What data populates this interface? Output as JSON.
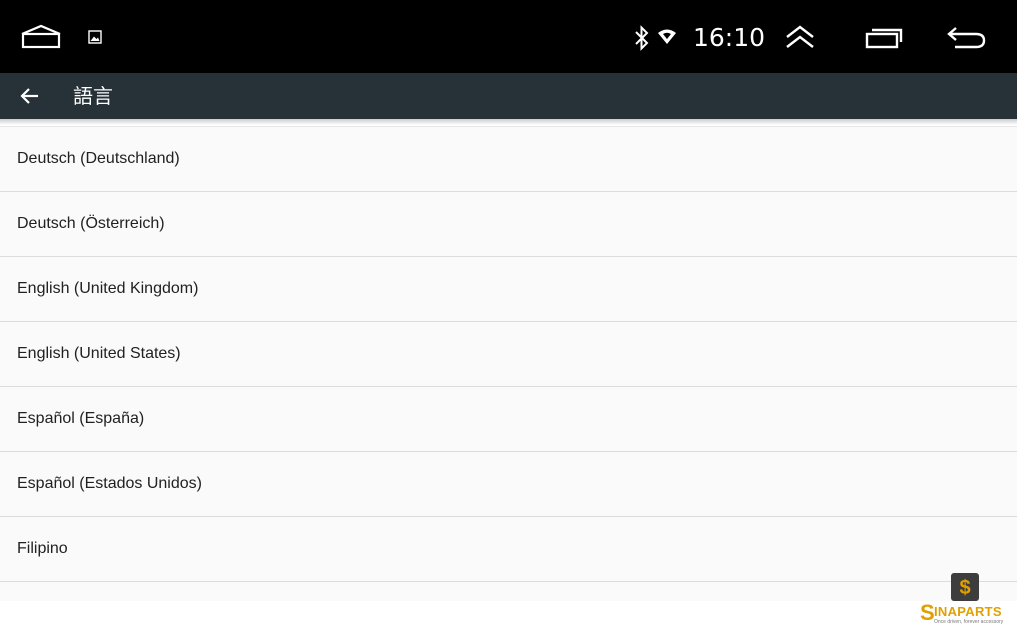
{
  "status_bar": {
    "time": "16:10",
    "icons": [
      "home-icon",
      "image-notification-icon",
      "bluetooth-icon",
      "wifi-icon",
      "expand-up-icon",
      "recent-apps-icon",
      "back-nav-icon"
    ]
  },
  "app_bar": {
    "title": "語言",
    "back_icon": "arrow-left-icon"
  },
  "languages": [
    "Deutsch (Deutschland)",
    "Deutsch (Österreich)",
    "English (United Kingdom)",
    "English (United States)",
    "Español (España)",
    "Español (Estados Unidos)",
    "Filipino"
  ],
  "watermark": {
    "initial": "S",
    "brand": "INAPARTS",
    "tagline": "Once driven, forever accessory"
  },
  "colors": {
    "status_bar": "#000000",
    "app_bar": "#263238",
    "list_background": "#fafafa",
    "divider": "#dcdcdc",
    "text": "#212121",
    "brand": "#e0a100"
  }
}
